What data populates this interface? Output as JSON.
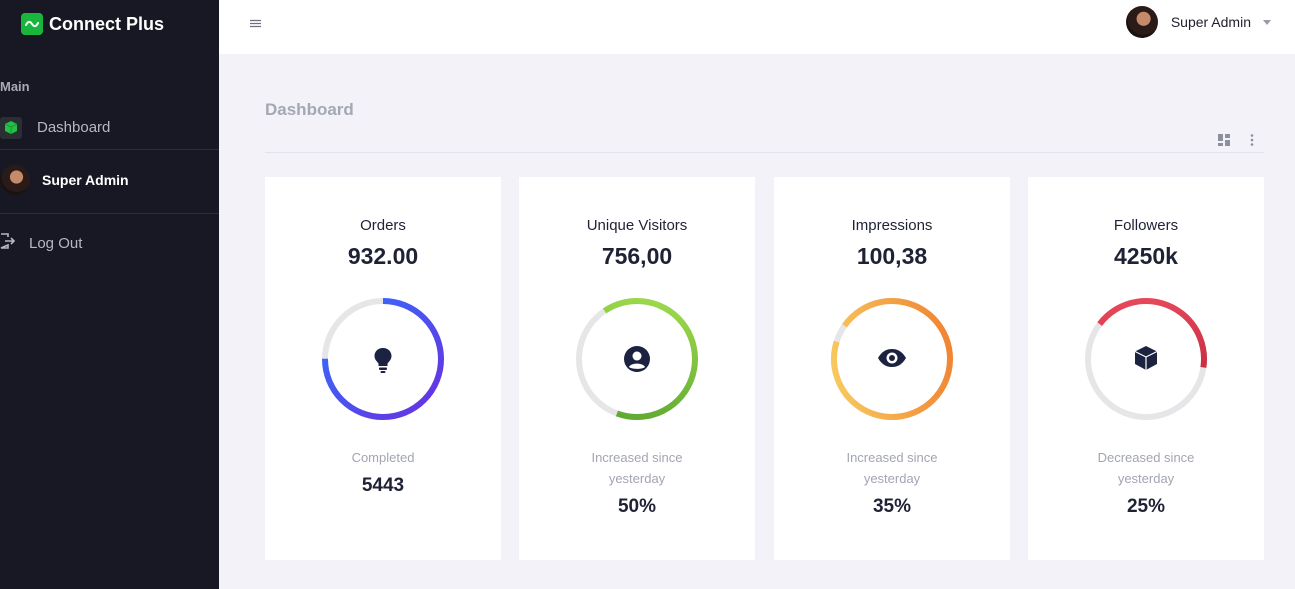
{
  "brand": {
    "name": "Connect Plus",
    "accent": "#19b53d"
  },
  "sidebar": {
    "section": "Main",
    "dashboard_label": "Dashboard",
    "profile_name": "Super Admin",
    "logout_label": "Log Out"
  },
  "topbar": {
    "user_name": "Super Admin"
  },
  "page": {
    "title": "Dashboard"
  },
  "cards": [
    {
      "label": "Orders",
      "value": "932.00",
      "sub": "Completed",
      "stat": "5443",
      "progress": 0.75,
      "colors": [
        "#2f73ff",
        "#6a2fe0"
      ],
      "icon": "lightbulb-icon"
    },
    {
      "label": "Unique Visitors",
      "value": "756,00",
      "sub": "Increased since yesterday",
      "stat": "50%",
      "progress": 0.65,
      "colors": [
        "#a6e04e",
        "#56a22e"
      ],
      "icon": "user-circle-icon"
    },
    {
      "label": "Impressions",
      "value": "100,38",
      "sub": "Increased since yesterday",
      "stat": "35%",
      "progress": 0.95,
      "colors": [
        "#f8d566",
        "#f0782a"
      ],
      "icon": "eye-icon"
    },
    {
      "label": "Followers",
      "value": "4250k",
      "sub": "Decreased since yesterday",
      "stat": "25%",
      "progress": 0.42,
      "colors": [
        "#f04f62",
        "#b2172d"
      ],
      "icon": "box-icon"
    }
  ]
}
